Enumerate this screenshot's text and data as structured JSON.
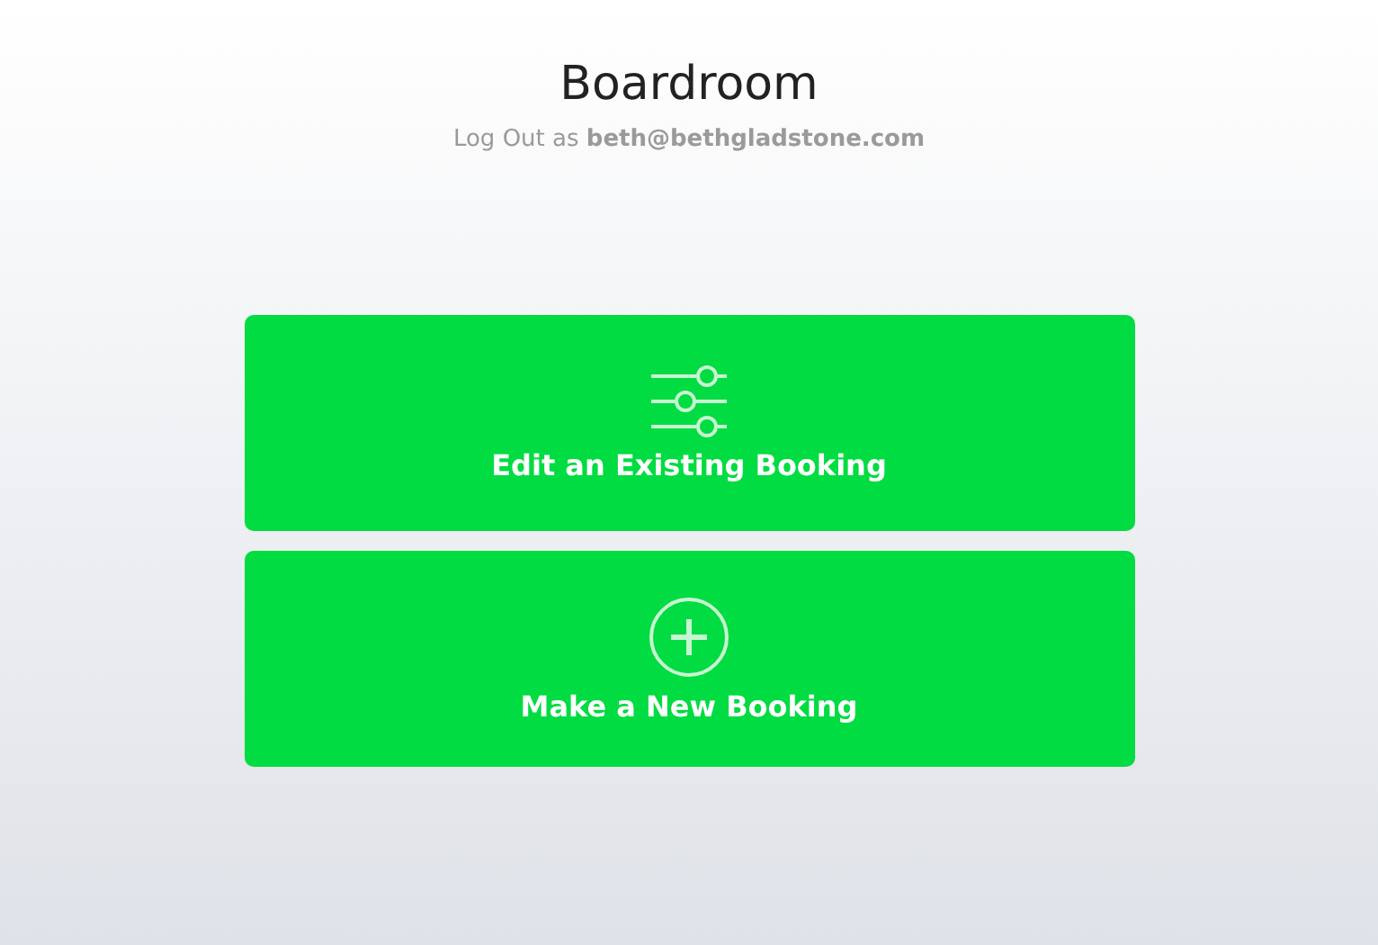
{
  "header": {
    "title": "Boardroom",
    "logout": "Log Out as **beth@bethgladstone.com**"
  },
  "actions": [
    {
      "kind": "sliders",
      "label": "Edit an Existing Booking"
    },
    {
      "kind": "plus",
      "label": "Make a New Booking"
    }
  ]
}
